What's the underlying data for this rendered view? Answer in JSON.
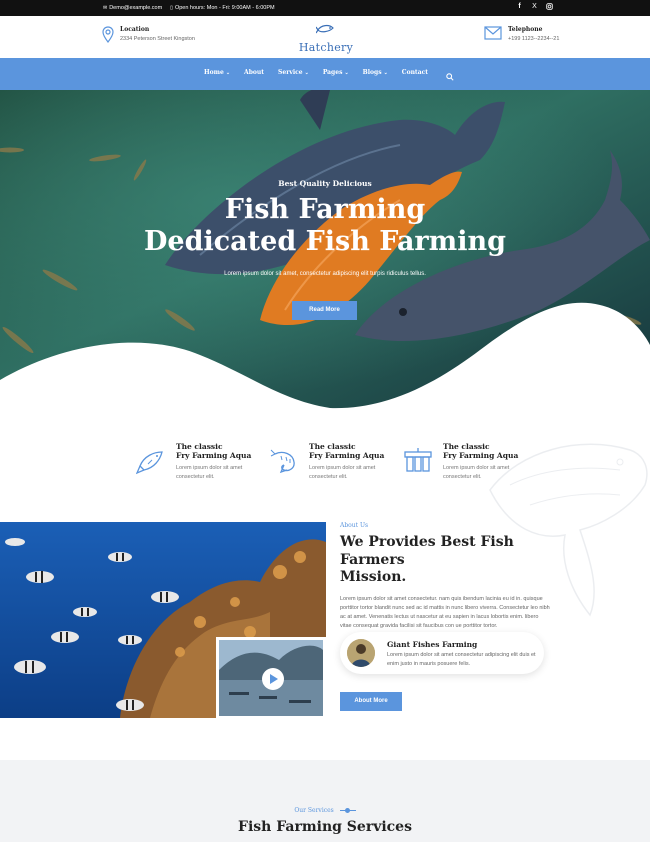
{
  "topbar": {
    "email": "Demo@example.com",
    "hours": "Open hours: Mon - Fri: 9:00AM - 6:00PM",
    "social": [
      "f",
      "X",
      "ig"
    ]
  },
  "header": {
    "location_label": "Location",
    "location_value": "2334 Peterson Street Kingston",
    "logo_text": "Hatchery",
    "telephone_label": "Telephone",
    "telephone_value": "+199 1123--2234--21"
  },
  "nav": {
    "items": [
      {
        "label": "Home",
        "has_caret": true
      },
      {
        "label": "About",
        "has_caret": false
      },
      {
        "label": "Service",
        "has_caret": true
      },
      {
        "label": "Pages",
        "has_caret": true
      },
      {
        "label": "Blogs",
        "has_caret": true
      },
      {
        "label": "Contact",
        "has_caret": false
      }
    ]
  },
  "hero": {
    "subtitle": "Best Quality Delicious",
    "title_line1": "Fish Farming",
    "title_line2": "Dedicated Fish Farming",
    "description": "Lorem ipsum dolor sit amet, consectetur adipiscing elit turpis ridiculus tellus.",
    "button": "Read More"
  },
  "features": [
    {
      "title_line1": "The classic",
      "title_line2": "Fry Farming Aqua",
      "desc": "Lorem ipsum dolor sit amet consectetur elit.",
      "icon": "fish-icon"
    },
    {
      "title_line1": "The classic",
      "title_line2": "Fry Farming Aqua",
      "desc": "Lorem ipsum dolor sit amet consectetur elit.",
      "icon": "shrimp-icon"
    },
    {
      "title_line1": "The classic",
      "title_line2": "Fry Farming Aqua",
      "desc": "Lorem ipsum dolor sit amet consectetur elit.",
      "icon": "water-filter-icon"
    }
  ],
  "about": {
    "tag": "About Us",
    "title_line1": "We Provides Best Fish Farmers",
    "title_line2": "Mission.",
    "paragraph": "Lorem ipsum dolor sit amet consectetur. nam quis ibendum lacinia eu id in. quisque porttitor tortor blandit nunc sed ac id mattis in nunc libero viverra. Consectetur leo nibh ac at amet. Venenatis lectus ut nascetur at eu sapien in lacus lobortis enim. libero vitae consequat gravida facilisi sit faucibus con ue porttitor tortor.",
    "card_title": "Giant Fishes Farming",
    "card_desc": "Lorem ipsum dolor sit amet consectetur adipiscing elit duis et enim justo in mauris posuere felis.",
    "button": "About More"
  },
  "services": {
    "tag": "Our Services",
    "title": "Fish Farming Services"
  },
  "colors": {
    "accent": "#5b95dd",
    "topbar": "#111111",
    "logo": "#3a6fb7"
  }
}
